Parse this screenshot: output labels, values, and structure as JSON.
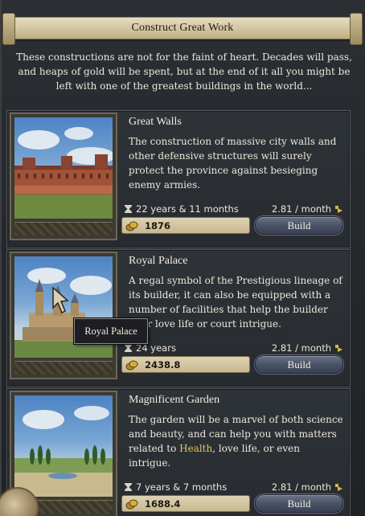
{
  "title": "Construct Great Work",
  "intro": "These constructions are not for the faint of heart. Decades will pass, and heaps of gold will be spent, but at the end of it all you might be left with one of the greatest buildings in the world...",
  "works": [
    {
      "name": "Great Walls",
      "desc": "The construction of massive city walls and other defensive structures will surely protect the province against besieging enemy armies.",
      "duration": "22 years & 11 months",
      "rate": "2.81 / month",
      "cost": "1876",
      "build_label": "Build"
    },
    {
      "name": "Royal Palace",
      "desc": "A regal symbol of the Prestigious lineage of its builder, it can also be equipped with a number of facilities that help the builder their love life or court intrigue.",
      "duration": "24 years",
      "rate": "2.81 / month",
      "cost": "2438.8",
      "build_label": "Build"
    },
    {
      "name": "Magnificent Garden",
      "desc_a": "The garden will be a marvel of both science and beauty, and can help you with matters related to ",
      "desc_highlight": "Health",
      "desc_b": ", love life, or even intrigue.",
      "duration": "7 years & 7 months",
      "rate": "2.81 / month",
      "cost": "1688.4",
      "build_label": "Build"
    }
  ],
  "tooltip": "Royal Palace",
  "colors": {
    "banner": "#d2c59f",
    "highlight": "#e3c45a",
    "button": "#4a5266"
  },
  "icons": [
    "hourglass-icon",
    "rate-arrow-icon",
    "gold-coins-icon",
    "pointer-cursor-icon"
  ]
}
